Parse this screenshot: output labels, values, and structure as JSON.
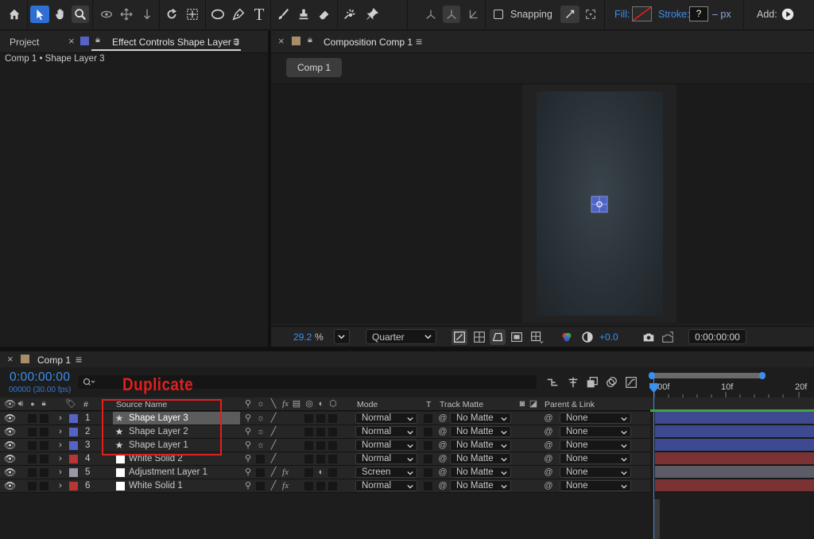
{
  "toolbar": {
    "snapping_label": "Snapping",
    "fill_label": "Fill:",
    "stroke_label": "Stroke:",
    "stroke_value": "?",
    "stroke_unit": "– px",
    "add_label": "Add:"
  },
  "left_panel": {
    "tab_project": "Project",
    "tab_effect_controls": "Effect Controls Shape Layer 3",
    "breadcrumb": "Comp 1 • Shape Layer 3"
  },
  "comp_panel": {
    "tab_label": "Composition Comp 1",
    "comp_button": "Comp 1",
    "zoom": "29.2",
    "zoom_unit": "%",
    "resolution": "Quarter",
    "exposure": "+0.0",
    "timecode": "0:00:00:00"
  },
  "timeline": {
    "tab_label": "Comp 1",
    "timecode": "0:00:00:00",
    "frames": "00000 (30.00 fps)",
    "search_placeholder": "",
    "annotation": "Duplicate",
    "col_number": "#",
    "col_source_name": "Source Name",
    "col_mode": "Mode",
    "col_t": "T",
    "col_track_matte": "Track Matte",
    "col_parent": "Parent & Link",
    "ruler": [
      "0:00f",
      "10f",
      "20f"
    ],
    "layers": [
      {
        "num": "1",
        "name": "Shape Layer 3",
        "type": "shape",
        "label_color": "#5563c9",
        "mode": "Normal",
        "matte": "No Matte",
        "parent": "None",
        "bar_color": "#3d4a8f",
        "selected": true
      },
      {
        "num": "2",
        "name": "Shape Layer 2",
        "type": "shape",
        "label_color": "#5563c9",
        "mode": "Normal",
        "matte": "No Matte",
        "parent": "None",
        "bar_color": "#3d4a8f",
        "selected": false
      },
      {
        "num": "3",
        "name": "Shape Layer 1",
        "type": "shape",
        "label_color": "#5563c9",
        "mode": "Normal",
        "matte": "No Matte",
        "parent": "None",
        "bar_color": "#3d4a8f",
        "selected": false
      },
      {
        "num": "4",
        "name": "White Solid 2",
        "type": "solid",
        "label_color": "#b83535",
        "mode": "Normal",
        "matte": "No Matte",
        "parent": "None",
        "bar_color": "#7a3232",
        "selected": false
      },
      {
        "num": "5",
        "name": "Adjustment Layer 1",
        "type": "solid",
        "label_color": "#9898a6",
        "mode": "Screen",
        "matte": "No Matte",
        "parent": "None",
        "bar_color": "#5c5c66",
        "selected": false
      },
      {
        "num": "6",
        "name": "White Solid 1",
        "type": "solid",
        "label_color": "#b83535",
        "mode": "Normal",
        "matte": "No Matte",
        "parent": "None",
        "bar_color": "#7a3232",
        "selected": false
      }
    ]
  },
  "colors": {
    "accent": "#2d6fd3",
    "timecode": "#3b8ff0",
    "annotation": "#e21f1f"
  }
}
